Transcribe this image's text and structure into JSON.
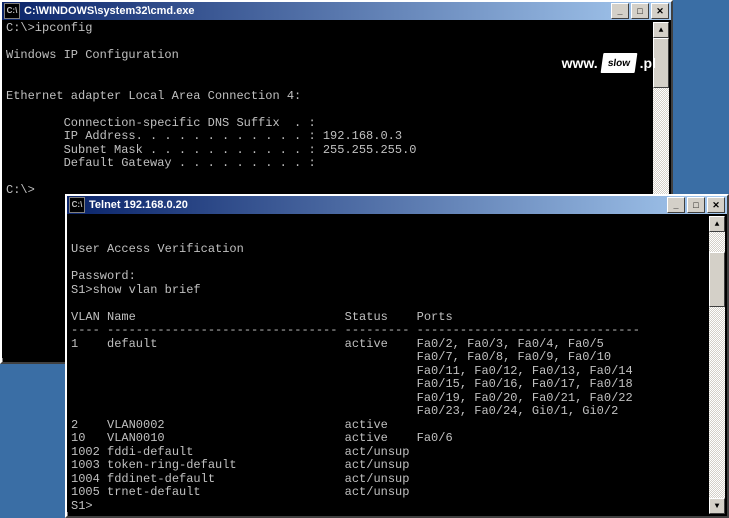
{
  "watermark": {
    "prefix": "www.",
    "logo_text": "slow",
    "suffix": ".pl"
  },
  "window1": {
    "title": "C:\\WINDOWS\\system32\\cmd.exe",
    "lines": [
      "C:\\>ipconfig",
      "",
      "Windows IP Configuration",
      "",
      "",
      "Ethernet adapter Local Area Connection 4:",
      "",
      "        Connection-specific DNS Suffix  . :",
      "        IP Address. . . . . . . . . . . . : 192.168.0.3",
      "        Subnet Mask . . . . . . . . . . . : 255.255.255.0",
      "        Default Gateway . . . . . . . . . :",
      "",
      "C:\\>"
    ]
  },
  "window2": {
    "title": "Telnet 192.168.0.20",
    "lines": [
      "",
      "",
      "User Access Verification",
      "",
      "Password:",
      "S1>show vlan brief",
      "",
      "VLAN Name                             Status    Ports",
      "---- -------------------------------- --------- -------------------------------",
      "1    default                          active    Fa0/2, Fa0/3, Fa0/4, Fa0/5",
      "                                                Fa0/7, Fa0/8, Fa0/9, Fa0/10",
      "                                                Fa0/11, Fa0/12, Fa0/13, Fa0/14",
      "                                                Fa0/15, Fa0/16, Fa0/17, Fa0/18",
      "                                                Fa0/19, Fa0/20, Fa0/21, Fa0/22",
      "                                                Fa0/23, Fa0/24, Gi0/1, Gi0/2",
      "2    VLAN0002                         active",
      "10   VLAN0010                         active    Fa0/6",
      "1002 fddi-default                     act/unsup",
      "1003 token-ring-default               act/unsup",
      "1004 fddinet-default                  act/unsup",
      "1005 trnet-default                    act/unsup",
      "S1>"
    ]
  },
  "btn": {
    "min": "_",
    "max": "□",
    "close": "✕",
    "up": "▲",
    "down": "▼"
  },
  "icon": {
    "cmd": "C:\\"
  }
}
